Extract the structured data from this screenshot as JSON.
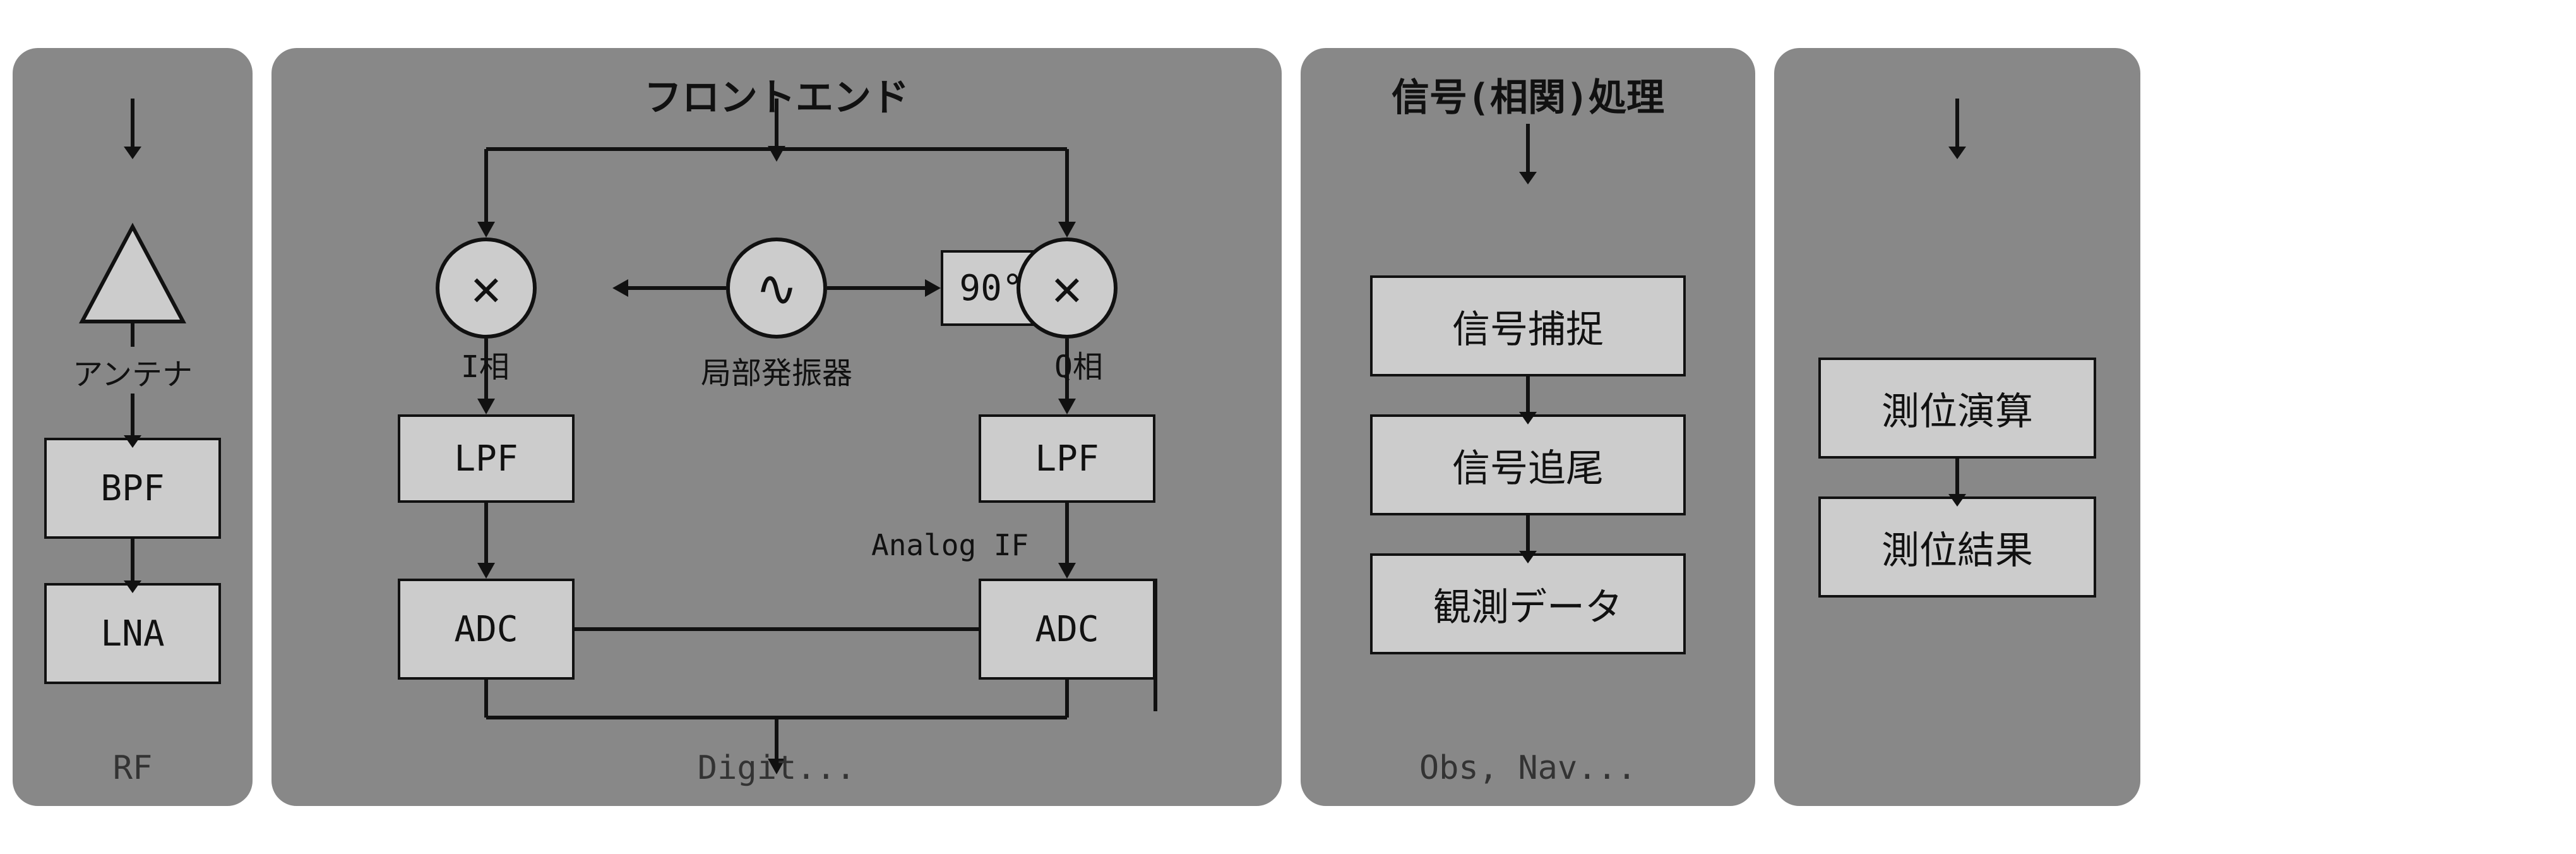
{
  "rf": {
    "label": "RF",
    "antenna_label": "アンテナ",
    "bpf_label": "BPF",
    "lna_label": "LNA"
  },
  "frontend": {
    "title": "フロントエンド",
    "i_phase_label": "I相",
    "q_phase_label": "Q相",
    "local_osc_label": "局部発振器",
    "phase_90_label": "90°",
    "lpf_i_label": "LPF",
    "lpf_q_label": "LPF",
    "adc_i_label": "ADC",
    "adc_q_label": "ADC",
    "analog_if_label": "Analog IF",
    "digit_label": "Digit..."
  },
  "signal": {
    "title": "信号(相関)処理",
    "capture_label": "信号捕捉",
    "tracking_label": "信号追尾",
    "obs_label": "観測データ",
    "bottom_label": "Obs, Nav..."
  },
  "position": {
    "calc_label": "測位演算",
    "result_label": "測位結果"
  }
}
